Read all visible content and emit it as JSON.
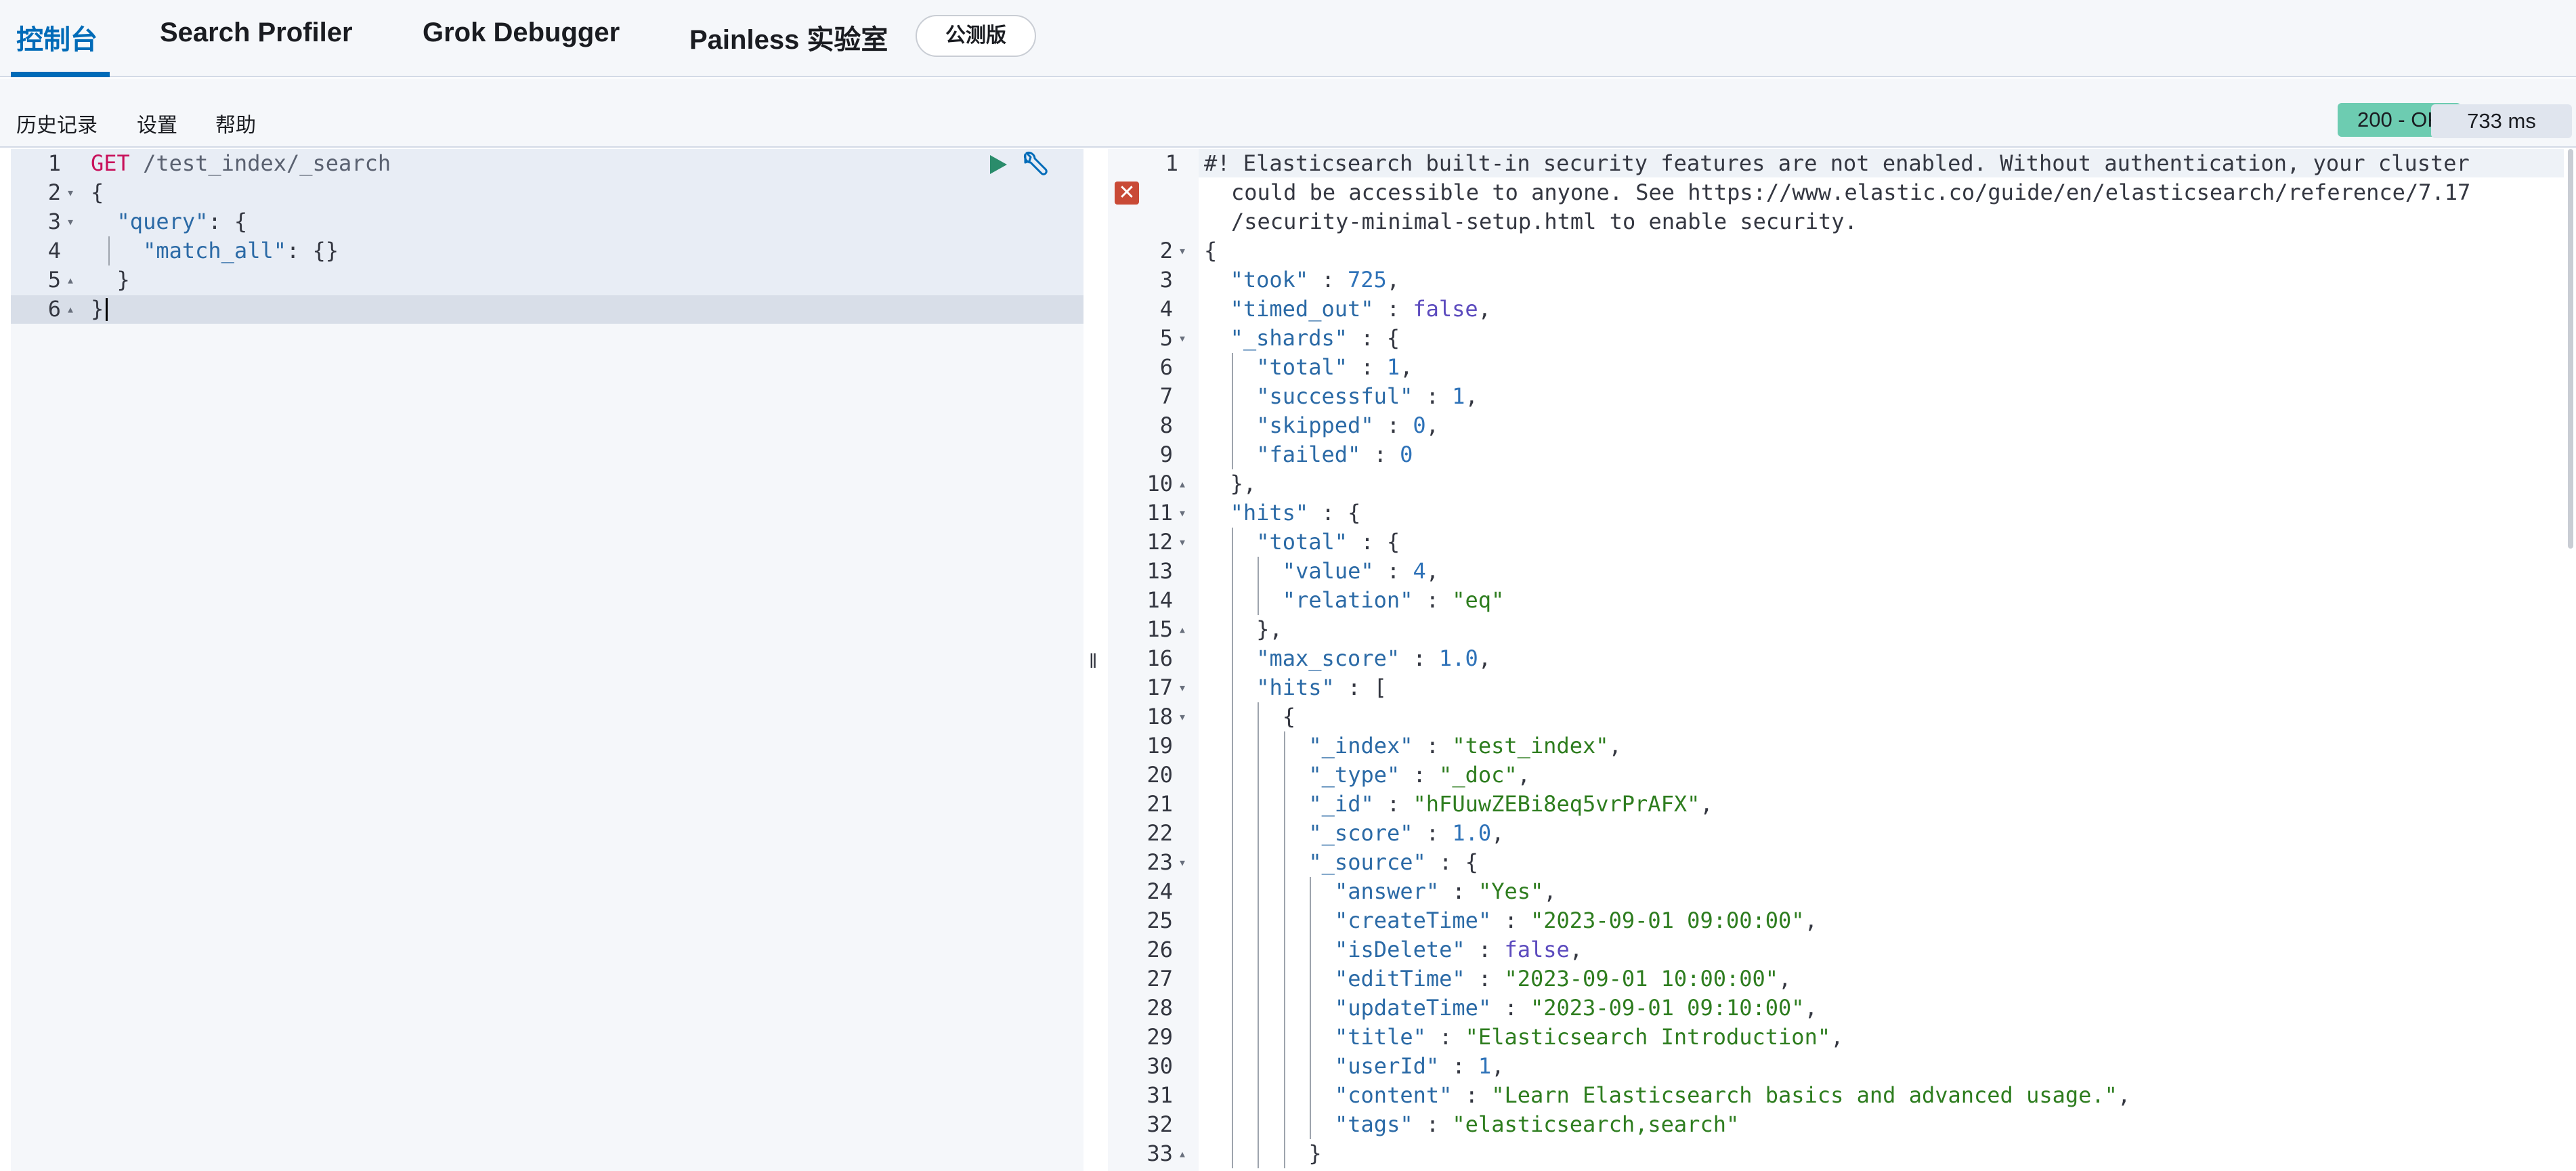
{
  "tabs": [
    {
      "label": "控制台",
      "active": true
    },
    {
      "label": "Search Profiler",
      "active": false
    },
    {
      "label": "Grok Debugger",
      "active": false
    },
    {
      "label": "Painless 实验室",
      "active": false
    }
  ],
  "beta_badge": "公测版",
  "toolbar": {
    "history": "历史记录",
    "settings": "设置",
    "help": "帮助"
  },
  "response_status": "200 - OK",
  "response_time": "733 ms",
  "colors": {
    "accent": "#006bb8",
    "status_ok": "#6dccb1",
    "error": "#c94a36"
  },
  "icons": [
    "play-icon",
    "wrench-icon",
    "error-icon",
    "resize-handle-icon"
  ],
  "request": {
    "lines": [
      {
        "n": "1",
        "fold": ""
      },
      {
        "n": "2",
        "fold": "down"
      },
      {
        "n": "3",
        "fold": "down"
      },
      {
        "n": "4",
        "fold": ""
      },
      {
        "n": "5",
        "fold": "up"
      },
      {
        "n": "6",
        "fold": "up"
      }
    ],
    "method": "GET",
    "path": " /test_index/_search",
    "open_brace": "{",
    "query_key": "\"query\"",
    "query_rest": ": {",
    "match_all_key": "\"match_all\"",
    "match_all_rest": ": {}",
    "inner_close": "}",
    "outer_close": "}"
  },
  "response": {
    "warning_lines": [
      "#! Elasticsearch built-in security features are not enabled. Without authentication, your cluster",
      "could be accessible to anyone. See https://www.elastic.co/guide/en/elasticsearch/reference/7.17",
      "/security-minimal-setup.html to enable security."
    ],
    "lines": [
      {
        "n": "2",
        "fold": "down",
        "indent": 0,
        "key": "",
        "sep": "",
        "val": "{",
        "vt": "punct"
      },
      {
        "n": "3",
        "fold": "",
        "indent": 1,
        "key": "\"took\"",
        "sep": " : ",
        "val": "725",
        "vt": "num",
        "tail": ","
      },
      {
        "n": "4",
        "fold": "",
        "indent": 1,
        "key": "\"timed_out\"",
        "sep": " : ",
        "val": "false",
        "vt": "bool",
        "tail": ","
      },
      {
        "n": "5",
        "fold": "down",
        "indent": 1,
        "key": "\"_shards\"",
        "sep": " : ",
        "val": "{",
        "vt": "punct"
      },
      {
        "n": "6",
        "fold": "",
        "indent": 2,
        "key": "\"total\"",
        "sep": " : ",
        "val": "1",
        "vt": "num",
        "tail": ","
      },
      {
        "n": "7",
        "fold": "",
        "indent": 2,
        "key": "\"successful\"",
        "sep": " : ",
        "val": "1",
        "vt": "num",
        "tail": ","
      },
      {
        "n": "8",
        "fold": "",
        "indent": 2,
        "key": "\"skipped\"",
        "sep": " : ",
        "val": "0",
        "vt": "num",
        "tail": ","
      },
      {
        "n": "9",
        "fold": "",
        "indent": 2,
        "key": "\"failed\"",
        "sep": " : ",
        "val": "0",
        "vt": "num"
      },
      {
        "n": "10",
        "fold": "up",
        "indent": 1,
        "key": "",
        "sep": "",
        "val": "},",
        "vt": "punct"
      },
      {
        "n": "11",
        "fold": "down",
        "indent": 1,
        "key": "\"hits\"",
        "sep": " : ",
        "val": "{",
        "vt": "punct"
      },
      {
        "n": "12",
        "fold": "down",
        "indent": 2,
        "key": "\"total\"",
        "sep": " : ",
        "val": "{",
        "vt": "punct"
      },
      {
        "n": "13",
        "fold": "",
        "indent": 3,
        "key": "\"value\"",
        "sep": " : ",
        "val": "4",
        "vt": "num",
        "tail": ","
      },
      {
        "n": "14",
        "fold": "",
        "indent": 3,
        "key": "\"relation\"",
        "sep": " : ",
        "val": "\"eq\"",
        "vt": "str"
      },
      {
        "n": "15",
        "fold": "up",
        "indent": 2,
        "key": "",
        "sep": "",
        "val": "},",
        "vt": "punct"
      },
      {
        "n": "16",
        "fold": "",
        "indent": 2,
        "key": "\"max_score\"",
        "sep": " : ",
        "val": "1.0",
        "vt": "num",
        "tail": ","
      },
      {
        "n": "17",
        "fold": "down",
        "indent": 2,
        "key": "\"hits\"",
        "sep": " : ",
        "val": "[",
        "vt": "punct"
      },
      {
        "n": "18",
        "fold": "down",
        "indent": 3,
        "key": "",
        "sep": "",
        "val": "{",
        "vt": "punct"
      },
      {
        "n": "19",
        "fold": "",
        "indent": 4,
        "key": "\"_index\"",
        "sep": " : ",
        "val": "\"test_index\"",
        "vt": "str",
        "tail": ","
      },
      {
        "n": "20",
        "fold": "",
        "indent": 4,
        "key": "\"_type\"",
        "sep": " : ",
        "val": "\"_doc\"",
        "vt": "str",
        "tail": ","
      },
      {
        "n": "21",
        "fold": "",
        "indent": 4,
        "key": "\"_id\"",
        "sep": " : ",
        "val": "\"hFUuwZEBi8eq5vrPrAFX\"",
        "vt": "str",
        "tail": ","
      },
      {
        "n": "22",
        "fold": "",
        "indent": 4,
        "key": "\"_score\"",
        "sep": " : ",
        "val": "1.0",
        "vt": "num",
        "tail": ","
      },
      {
        "n": "23",
        "fold": "down",
        "indent": 4,
        "key": "\"_source\"",
        "sep": " : ",
        "val": "{",
        "vt": "punct"
      },
      {
        "n": "24",
        "fold": "",
        "indent": 5,
        "key": "\"answer\"",
        "sep": " : ",
        "val": "\"Yes\"",
        "vt": "str",
        "tail": ","
      },
      {
        "n": "25",
        "fold": "",
        "indent": 5,
        "key": "\"createTime\"",
        "sep": " : ",
        "val": "\"2023-09-01 09:00:00\"",
        "vt": "str",
        "tail": ","
      },
      {
        "n": "26",
        "fold": "",
        "indent": 5,
        "key": "\"isDelete\"",
        "sep": " : ",
        "val": "false",
        "vt": "bool",
        "tail": ","
      },
      {
        "n": "27",
        "fold": "",
        "indent": 5,
        "key": "\"editTime\"",
        "sep": " : ",
        "val": "\"2023-09-01 10:00:00\"",
        "vt": "str",
        "tail": ","
      },
      {
        "n": "28",
        "fold": "",
        "indent": 5,
        "key": "\"updateTime\"",
        "sep": " : ",
        "val": "\"2023-09-01 09:10:00\"",
        "vt": "str",
        "tail": ","
      },
      {
        "n": "29",
        "fold": "",
        "indent": 5,
        "key": "\"title\"",
        "sep": " : ",
        "val": "\"Elasticsearch Introduction\"",
        "vt": "str",
        "tail": ","
      },
      {
        "n": "30",
        "fold": "",
        "indent": 5,
        "key": "\"userId\"",
        "sep": " : ",
        "val": "1",
        "vt": "num",
        "tail": ","
      },
      {
        "n": "31",
        "fold": "",
        "indent": 5,
        "key": "\"content\"",
        "sep": " : ",
        "val": "\"Learn Elasticsearch basics and advanced usage.\"",
        "vt": "str",
        "tail": ","
      },
      {
        "n": "32",
        "fold": "",
        "indent": 5,
        "key": "\"tags\"",
        "sep": " : ",
        "val": "\"elasticsearch,search\"",
        "vt": "str"
      },
      {
        "n": "33",
        "fold": "up",
        "indent": 4,
        "key": "",
        "sep": "",
        "val": "}",
        "vt": "punct"
      }
    ]
  }
}
